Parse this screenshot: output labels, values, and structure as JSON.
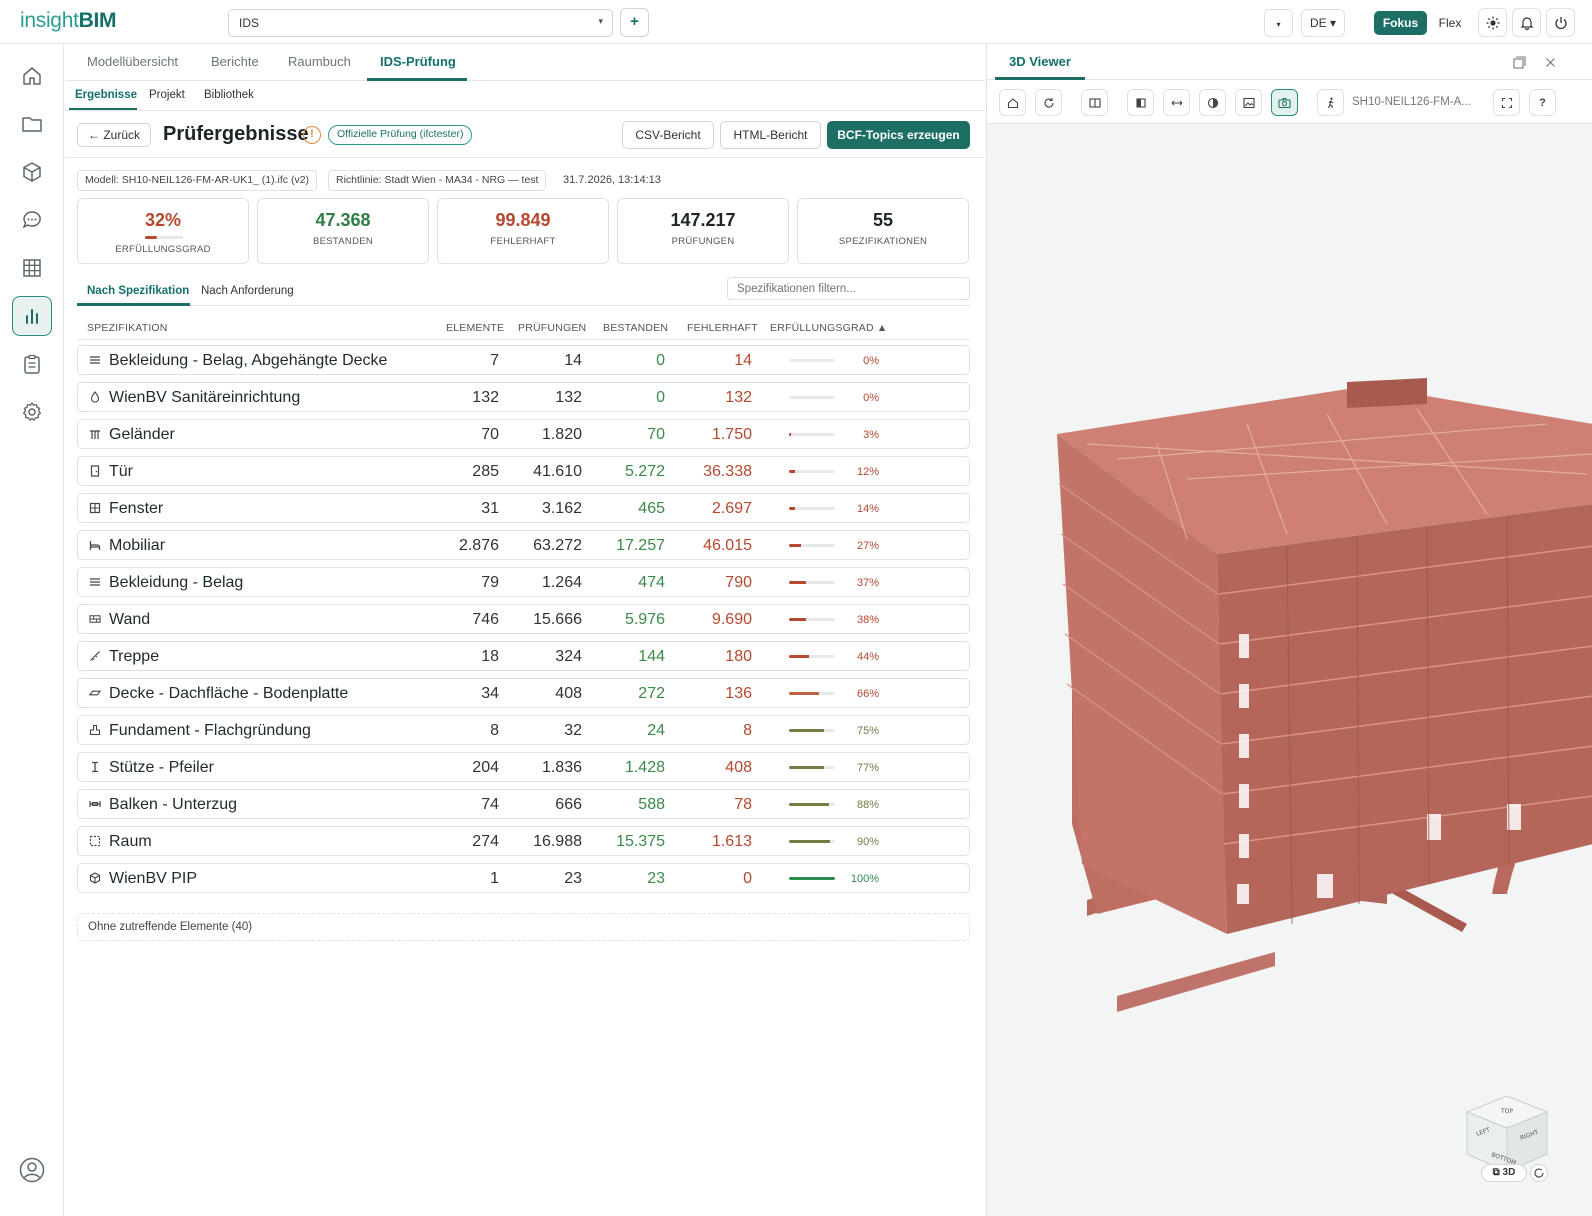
{
  "app": {
    "logo_part1": "insight",
    "logo_part2": "BIM",
    "project_select": "IDS",
    "add_label": "+",
    "lang": "DE ▾",
    "mode_fokus": "Fokus",
    "mode_flex": "Flex",
    "colors": {
      "primary": "#1d6f66",
      "ok": "#3a8a4a",
      "error": "#b5482f"
    }
  },
  "rail": {
    "items": [
      "home-icon",
      "folder-icon",
      "cube-icon",
      "chat-icon",
      "grid-icon",
      "chart-icon",
      "clipboard-icon",
      "gear-icon"
    ],
    "active": "chart-icon",
    "bottom": "user-icon"
  },
  "tabs": [
    "Modellübersicht",
    "Berichte",
    "Raumbuch",
    "IDS-Prüfung"
  ],
  "subtabs": [
    "Ergebnisse",
    "Projekt",
    "Bibliothek"
  ],
  "header": {
    "back": "← Zurück",
    "title": "Prüfergebnisse",
    "warn": "!",
    "badge": "Offizielle Prüfung (ifctester)",
    "csv": "CSV-Bericht",
    "html": "HTML-Bericht",
    "bcf": "BCF-Topics erzeugen"
  },
  "meta": {
    "model": "Modell: SH10-NEIL126-FM-AR-UK1_ (1).ifc (v2)",
    "guideline": "Richtlinie: Stadt Wien - MA34 - NRG — test",
    "date": "31.7.2026, 13:14:13"
  },
  "stats": [
    {
      "value": "32%",
      "label": "ERFÜLLUNGSGRAD",
      "color": "#b5482f",
      "fraction": 0.32
    },
    {
      "value": "47.368",
      "label": "BESTANDEN",
      "color": "#2e7d45"
    },
    {
      "value": "99.849",
      "label": "FEHLERHAFT",
      "color": "#b5482f"
    },
    {
      "value": "147.217",
      "label": "PRÜFUNGEN",
      "color": "#1d2625"
    },
    {
      "value": "55",
      "label": "SPEZIFIKATIONEN",
      "color": "#1d2625"
    }
  ],
  "view_tabs": [
    "Nach Spezifikation",
    "Nach Anforderung"
  ],
  "filter_placeholder": "Spezifikationen filtern...",
  "table": {
    "headers": [
      "SPEZIFIKATION",
      "ELEMENTE",
      "PRÜFUNGEN",
      "BESTANDEN",
      "FEHLERHAFT",
      "ERFÜLLUNGSGRAD ▲"
    ],
    "rows": [
      {
        "icon": "lines-icon",
        "name": "Bekleidung - Belag, Abgehängte Decke",
        "elemente": "7",
        "pruefungen": "14",
        "bestanden": "0",
        "fehlerhaft": "14",
        "pct": "0%",
        "fraction": 0.0
      },
      {
        "icon": "drop-icon",
        "name": "WienBV Sanitäreinrichtung",
        "elemente": "132",
        "pruefungen": "132",
        "bestanden": "0",
        "fehlerhaft": "132",
        "pct": "0%",
        "fraction": 0.0
      },
      {
        "icon": "railing-icon",
        "name": "Geländer",
        "elemente": "70",
        "pruefungen": "1.820",
        "bestanden": "70",
        "fehlerhaft": "1.750",
        "pct": "3%",
        "fraction": 0.03
      },
      {
        "icon": "door-icon",
        "name": "Tür",
        "elemente": "285",
        "pruefungen": "41.610",
        "bestanden": "5.272",
        "fehlerhaft": "36.338",
        "pct": "12%",
        "fraction": 0.12
      },
      {
        "icon": "window-icon",
        "name": "Fenster",
        "elemente": "31",
        "pruefungen": "3.162",
        "bestanden": "465",
        "fehlerhaft": "2.697",
        "pct": "14%",
        "fraction": 0.14
      },
      {
        "icon": "bed-icon",
        "name": "Mobiliar",
        "elemente": "2.876",
        "pruefungen": "63.272",
        "bestanden": "17.257",
        "fehlerhaft": "46.015",
        "pct": "27%",
        "fraction": 0.27
      },
      {
        "icon": "lines-icon",
        "name": "Bekleidung - Belag",
        "elemente": "79",
        "pruefungen": "1.264",
        "bestanden": "474",
        "fehlerhaft": "790",
        "pct": "37%",
        "fraction": 0.37
      },
      {
        "icon": "wall-icon",
        "name": "Wand",
        "elemente": "746",
        "pruefungen": "15.666",
        "bestanden": "5.976",
        "fehlerhaft": "9.690",
        "pct": "38%",
        "fraction": 0.38
      },
      {
        "icon": "stairs-icon",
        "name": "Treppe",
        "elemente": "18",
        "pruefungen": "324",
        "bestanden": "144",
        "fehlerhaft": "180",
        "pct": "44%",
        "fraction": 0.44
      },
      {
        "icon": "slab-icon",
        "name": "Decke - Dachfläche - Bodenplatte",
        "elemente": "34",
        "pruefungen": "408",
        "bestanden": "272",
        "fehlerhaft": "136",
        "pct": "66%",
        "fraction": 0.66
      },
      {
        "icon": "foundation-icon",
        "name": "Fundament - Flachgründung",
        "elemente": "8",
        "pruefungen": "32",
        "bestanden": "24",
        "fehlerhaft": "8",
        "pct": "75%",
        "fraction": 0.75
      },
      {
        "icon": "column-icon",
        "name": "Stütze - Pfeiler",
        "elemente": "204",
        "pruefungen": "1.836",
        "bestanden": "1.428",
        "fehlerhaft": "408",
        "pct": "77%",
        "fraction": 0.77
      },
      {
        "icon": "beam-icon",
        "name": "Balken - Unterzug",
        "elemente": "74",
        "pruefungen": "666",
        "bestanden": "588",
        "fehlerhaft": "78",
        "pct": "88%",
        "fraction": 0.88
      },
      {
        "icon": "space-icon",
        "name": "Raum",
        "elemente": "274",
        "pruefungen": "16.988",
        "bestanden": "15.375",
        "fehlerhaft": "1.613",
        "pct": "90%",
        "fraction": 0.9
      },
      {
        "icon": "box-icon",
        "name": "WienBV PIP",
        "elemente": "1",
        "pruefungen": "23",
        "bestanden": "23",
        "fehlerhaft": "0",
        "pct": "100%",
        "fraction": 1.0
      }
    ],
    "footer": "Ohne zutreffende Elemente (40)"
  },
  "viewer": {
    "title": "3D Viewer",
    "model_name": "SH10-NEIL126-FM-A...",
    "badge": "⧉ 3D",
    "cube_faces": [
      "TOP",
      "LEFT",
      "RIGHT",
      "BOTTOM"
    ]
  }
}
